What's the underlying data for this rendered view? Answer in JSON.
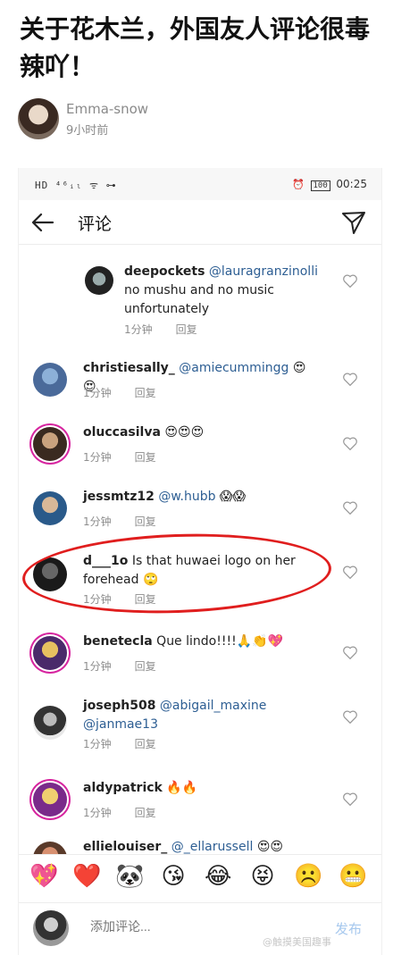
{
  "article": {
    "title": "关于花木兰，外国友人评论很毒辣吖！",
    "author": "Emma-snow",
    "time": "9小时前"
  },
  "status_bar": {
    "left": "HD ⁴⁶ᵢₗ ᯤ ⊶",
    "battery": "100",
    "time": "00:25"
  },
  "screen": {
    "title": "评论",
    "back_icon": "arrow-left-icon",
    "send_icon": "paper-plane-icon"
  },
  "comments": [
    {
      "user": "deepockets",
      "text": "@lauragranzinolli no mushu and no music unfortunately",
      "mention": "@lauragranzinolli",
      "body": " no mushu and no music unfortunately",
      "time": "1分钟",
      "reply": "回复",
      "emoji": ""
    },
    {
      "user": "christiesally_",
      "mention": "@amiecummingg",
      "body": "",
      "time": "1分钟",
      "reply": "回复",
      "emoji": "😍😍"
    },
    {
      "user": "oluccasilva",
      "mention": "",
      "body": "",
      "time": "1分钟",
      "reply": "回复",
      "emoji": "😍😍😍"
    },
    {
      "user": "jessmtz12",
      "mention": "@w.hubb",
      "body": "",
      "time": "1分钟",
      "reply": "回复",
      "emoji": "😱😱"
    },
    {
      "user": "d___1o",
      "mention": "",
      "body": " Is that huwaei logo on her forehead",
      "time": "1分钟",
      "reply": "回复",
      "emoji": "🙄"
    },
    {
      "user": "benetecla",
      "mention": "",
      "body": " Que lindo!!!!",
      "time": "1分钟",
      "reply": "回复",
      "emoji": "🙏👏💖"
    },
    {
      "user": "joseph508",
      "mention": "@abigail_maxine @janmae13",
      "body": "",
      "time": "1分钟",
      "reply": "回复",
      "emoji": ""
    },
    {
      "user": "aldypatrick",
      "mention": "",
      "body": "",
      "time": "1分钟",
      "reply": "回复",
      "emoji": "🔥🔥"
    },
    {
      "user": "ellielouiser_",
      "mention": "@_ellarussell",
      "body": "",
      "time": "",
      "reply": "",
      "emoji": "😍😍"
    }
  ],
  "emoji_bar": [
    "💖",
    "❤️",
    "🐼",
    "😘",
    "😂",
    "😝",
    "☹️",
    "😬"
  ],
  "compose": {
    "placeholder": "添加评论...",
    "post_label": "发布"
  },
  "watermark": "@触摸美国趣事",
  "colors": {
    "mention": "#2d5e93",
    "highlight_circle": "#e01e1e",
    "post_button": "#a6c8ee"
  }
}
